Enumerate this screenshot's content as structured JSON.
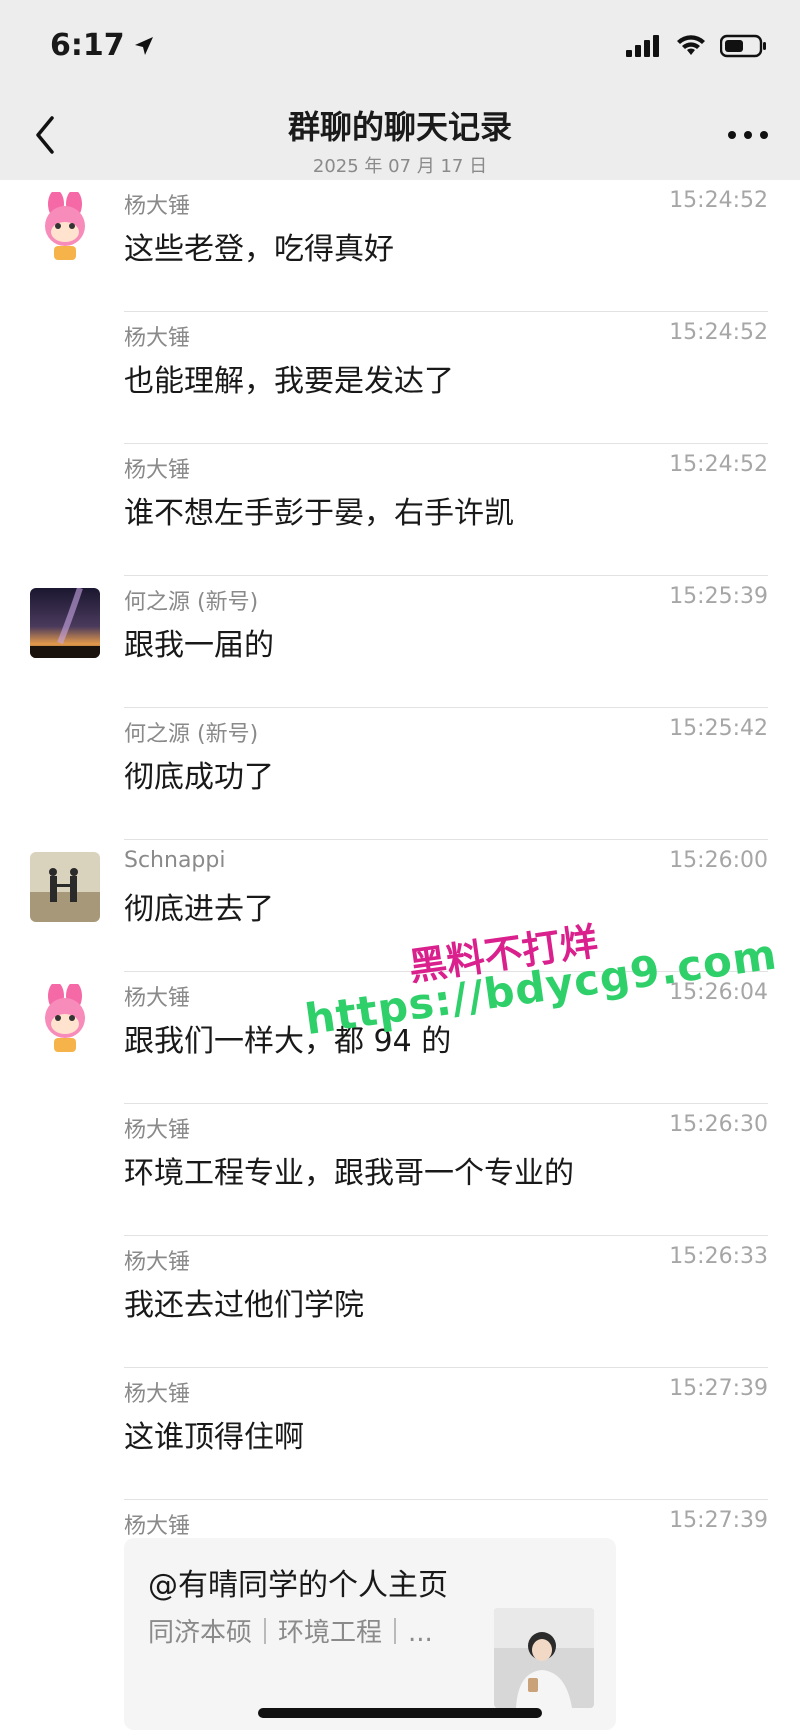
{
  "status_bar": {
    "time": "6:17"
  },
  "header": {
    "title": "群聊的聊天记录",
    "date": "2025 年 07 月 17 日"
  },
  "messages": [
    {
      "sender": "杨大锤",
      "time": "15:24:52",
      "text": "这些老登，吃得真好"
    },
    {
      "sender": "杨大锤",
      "time": "15:24:52",
      "text": "也能理解，我要是发达了"
    },
    {
      "sender": "杨大锤",
      "time": "15:24:52",
      "text": "谁不想左手彭于晏，右手许凯"
    },
    {
      "sender": "何之源 (新号)",
      "time": "15:25:39",
      "text": "跟我一届的"
    },
    {
      "sender": "何之源 (新号)",
      "time": "15:25:42",
      "text": "彻底成功了"
    },
    {
      "sender": "Schnappi",
      "time": "15:26:00",
      "text": "彻底进去了"
    },
    {
      "sender": "杨大锤",
      "time": "15:26:04",
      "text": "跟我们一样大，都 94 的"
    },
    {
      "sender": "杨大锤",
      "time": "15:26:30",
      "text": "环境工程专业，跟我哥一个专业的"
    },
    {
      "sender": "杨大锤",
      "time": "15:26:33",
      "text": "我还去过他们学院"
    },
    {
      "sender": "杨大锤",
      "time": "15:27:39",
      "text": "这谁顶得住啊"
    },
    {
      "sender": "杨大锤",
      "time": "15:27:39",
      "text": ""
    }
  ],
  "card": {
    "title": "@有晴同学的个人主页",
    "subtitle": "同济本硕｜环境工程｜..."
  },
  "watermark": {
    "line1": "黑料不打烊",
    "line2": "https://bdycg9.com"
  }
}
